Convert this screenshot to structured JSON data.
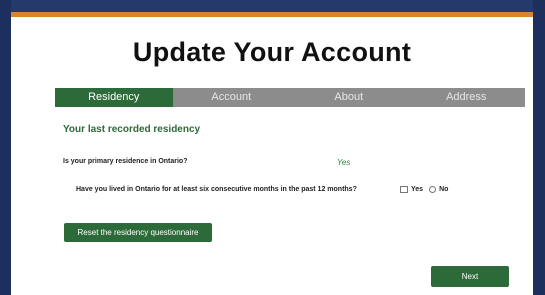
{
  "page": {
    "title": "Update Your Account"
  },
  "tabs": [
    {
      "label": "Residency",
      "active": true
    },
    {
      "label": "Account",
      "active": false
    },
    {
      "label": "About",
      "active": false
    },
    {
      "label": "Address",
      "active": false
    }
  ],
  "section": {
    "heading": "Your last recorded residency"
  },
  "questions": {
    "primary_residence": {
      "text": "Is your primary residence in Ontario?",
      "answer": "Yes"
    },
    "six_months": {
      "text": "Have you lived in Ontario for at least six consecutive months in the past 12 months?",
      "option_yes": "Yes",
      "option_no": "No"
    }
  },
  "buttons": {
    "reset": "Reset the residency questionnaire",
    "next": "Next"
  },
  "colors": {
    "accent_green": "#2d6a3a",
    "answer_green": "#2d8a3a",
    "top_border_orange": "#d9832b",
    "background_navy": "#233a6b",
    "tab_gray": "#8c8c8c"
  }
}
